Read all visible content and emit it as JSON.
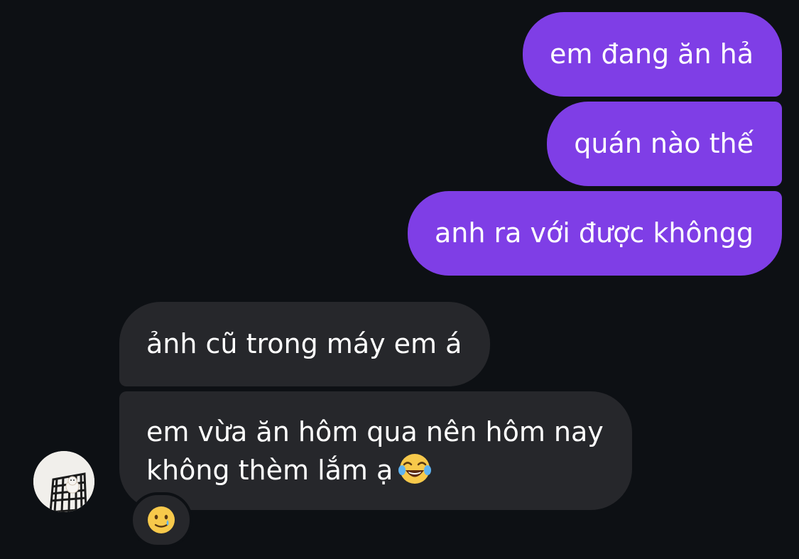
{
  "messages": {
    "outgoing": [
      {
        "text": "em đang ăn hả"
      },
      {
        "text": "quán nào thế"
      },
      {
        "text": "anh ra với được khôngg"
      }
    ],
    "incoming": [
      {
        "text": "ảnh cũ trong máy em á"
      },
      {
        "lines": [
          "em vừa ăn hôm qua nên hôm nay",
          "không thèm lắm ạ"
        ],
        "emoji": "face-with-tears-of-joy"
      }
    ]
  },
  "reaction": {
    "emoji": "smiling-face-with-tear"
  },
  "colors": {
    "background": "#0d1014",
    "outgoing_bubble": "#7f3ee6",
    "incoming_bubble": "#26272b",
    "text": "#ffffff"
  }
}
